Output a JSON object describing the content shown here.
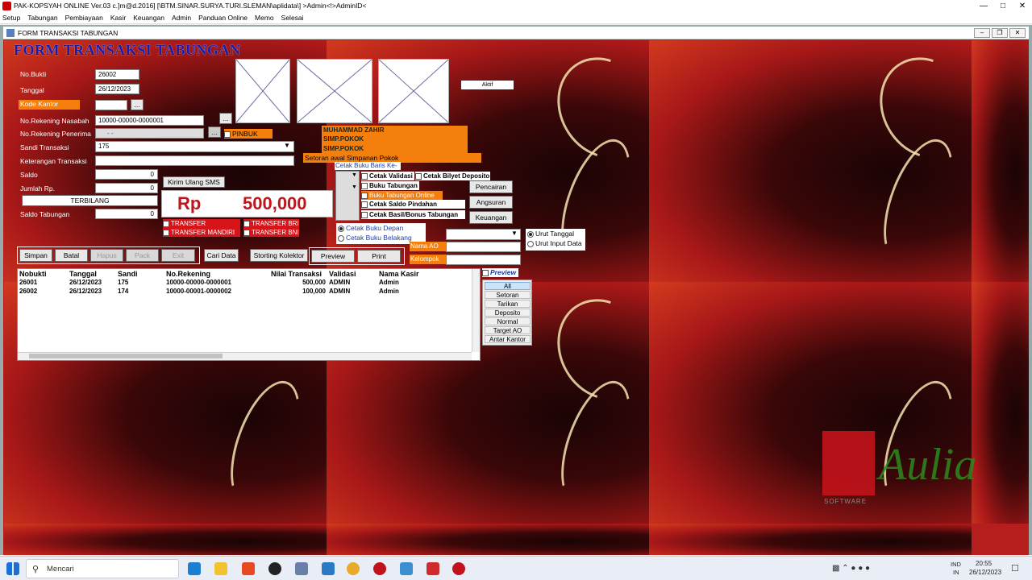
{
  "window": {
    "title": "PAK-KOPSYAH ONLINE Ver.03 c.]m@d.2016] [\\BTM.SINAR.SURYA.TURI.SLEMAN\\aplidata\\] >Admin<!>AdminID<"
  },
  "menu": [
    "Setup",
    "Tabungan",
    "Pembiayaan",
    "Kasir",
    "Keuangan",
    "Admin",
    "Panduan Online",
    "Memo",
    "Selesai"
  ],
  "child": {
    "title": "FORM TRANSAKSI TABUNGAN"
  },
  "form": {
    "heading": "FORM TRANSAKSI TABUNGAN",
    "labels": {
      "no_bukti": "No.Bukti",
      "tanggal": "Tanggal",
      "kode_kantor": "Kode Kantor",
      "rek_nasabah": "No.Rekening Nasabah",
      "rek_penerima": "No.Rekening Penerima",
      "sandi": "Sandi Transaksi",
      "keterangan": "Keterangan Transaksi",
      "saldo": "Saldo",
      "jumlah": "Jumlah Rp.",
      "saldo_tabungan": "Saldo Tabungan"
    },
    "values": {
      "no_bukti": "26002",
      "tanggal": "26/12/2023",
      "kode_kantor": "",
      "rek_nasabah": "10000-00000-0000001",
      "rek_penerima": "-   -",
      "sandi": "175",
      "keterangan": "",
      "saldo": "0",
      "jumlah": "0",
      "terbilang": "TERBILANG",
      "saldo_tabungan": "0"
    },
    "status": "Aktif",
    "pinbuk": "PINBUK Rek.",
    "info_lines": [
      "MUHAMMAD ZAHIR",
      "SIMP.POKOK",
      "SIMP.POKOK"
    ],
    "setoran_note": "Setoran awal Simpanan Pokok",
    "kirim_sms": "Kirim Ulang SMS",
    "amount_prefix": "Rp",
    "amount": "500,000",
    "transfers": [
      "TRANSFER MUAMALAT",
      "TRANSFER BRI",
      "TRANSFER MANDIRI",
      "TRANSFER BNI"
    ],
    "cetak_baris": "Cetak Buku Baris Ke-",
    "checks": [
      "Cetak Validasi",
      "Cetak Bilyet Deposito",
      "Buku Tabungan",
      "Buku Tabungan Online",
      "Cetak Saldo Pindahan",
      "Cetak Basil/Bonus Tabungan"
    ],
    "side_buttons": [
      "Pencairan",
      "Angsuran",
      "Keuangan"
    ],
    "radios_print": [
      "Cetak Buku Depan",
      "Cetak Buku  Belakang"
    ],
    "nama_ao": "Nama AO",
    "kelompok": "Kelompok",
    "radios_sort": [
      "Urut Tanggal",
      "Urut Input Data"
    ],
    "buttons": {
      "simpan": "Simpan",
      "batal": "Batal",
      "hapus": "Hapus",
      "pack": "Pack",
      "exit": "Exit",
      "cari": "Cari Data",
      "storting": "Storting Kolektor",
      "preview": "Preview",
      "print": "Print"
    },
    "preview_check": "Preview",
    "filters": [
      "All",
      "Setoran",
      "Tarikan",
      "Deposito",
      "Normal",
      "Target AO",
      "Antar Kantor"
    ]
  },
  "grid": {
    "headers": [
      "Nobukti",
      "Tanggal",
      "Sandi",
      "No.Rekening",
      "Nilai Transaksi",
      "Validasi",
      "Nama Kasir"
    ],
    "rows": [
      [
        "26001",
        "26/12/2023",
        "175",
        "10000-00000-0000001",
        "500,000",
        "ADMIN",
        "Admin"
      ],
      [
        "26002",
        "26/12/2023",
        "174",
        "10000-00001-0000002",
        "100,000",
        "ADMIN",
        "Admin"
      ]
    ]
  },
  "taskbar": {
    "search": "Mencari",
    "lang1": "IND",
    "lang2": "IN",
    "time": "20:55",
    "date": "26/12/2023"
  },
  "watermark": {
    "brand": "Aulia",
    "sub": "SOFTWARE"
  }
}
